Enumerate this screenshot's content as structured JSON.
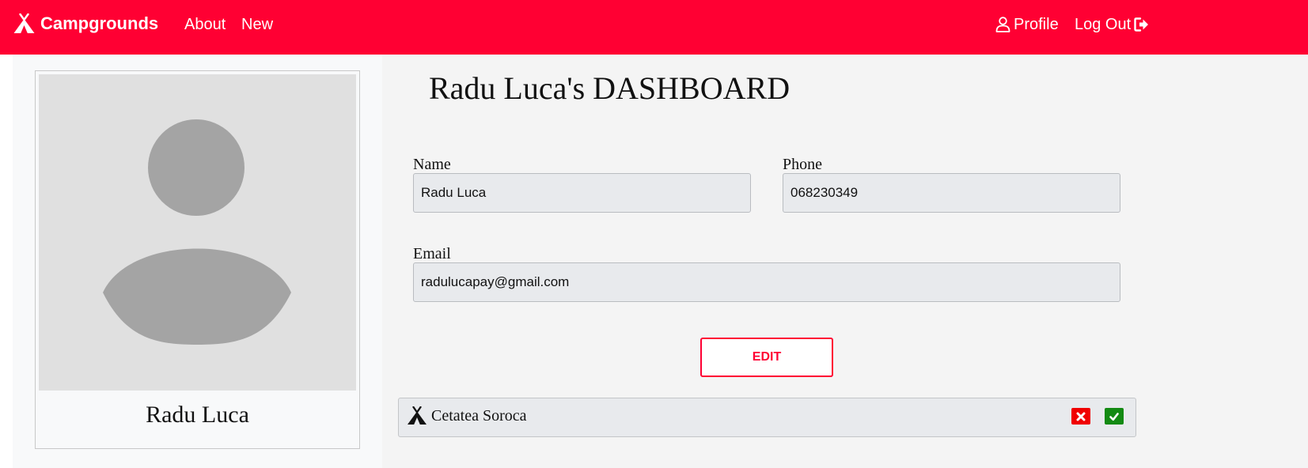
{
  "navbar": {
    "brand": "Campgrounds",
    "links": {
      "about": "About",
      "new": "New"
    },
    "profile_label": "Profile",
    "logout_label": "Log Out",
    "icons": {
      "brand": "tent-icon",
      "profile": "user-icon",
      "logout": "sign-out-icon"
    },
    "background_color": "#ff0033"
  },
  "profile_card": {
    "name": "Radu Luca",
    "avatar_icon": "user-placeholder-icon"
  },
  "dashboard": {
    "title": "Radu Luca's DASHBOARD",
    "fields": {
      "name": {
        "label": "Name",
        "value": "Radu Luca"
      },
      "phone": {
        "label": "Phone",
        "value": "068230349"
      },
      "email": {
        "label": "Email",
        "value": "radulucapay@gmail.com"
      }
    },
    "edit_label": "EDIT"
  },
  "campgrounds": [
    {
      "name": "Cetatea Soroca",
      "icon": "tent-icon",
      "actions": {
        "delete_icon": "x-mark-icon",
        "accept_icon": "check-icon",
        "delete_color": "#f00000",
        "accept_color": "#138a13"
      }
    }
  ]
}
